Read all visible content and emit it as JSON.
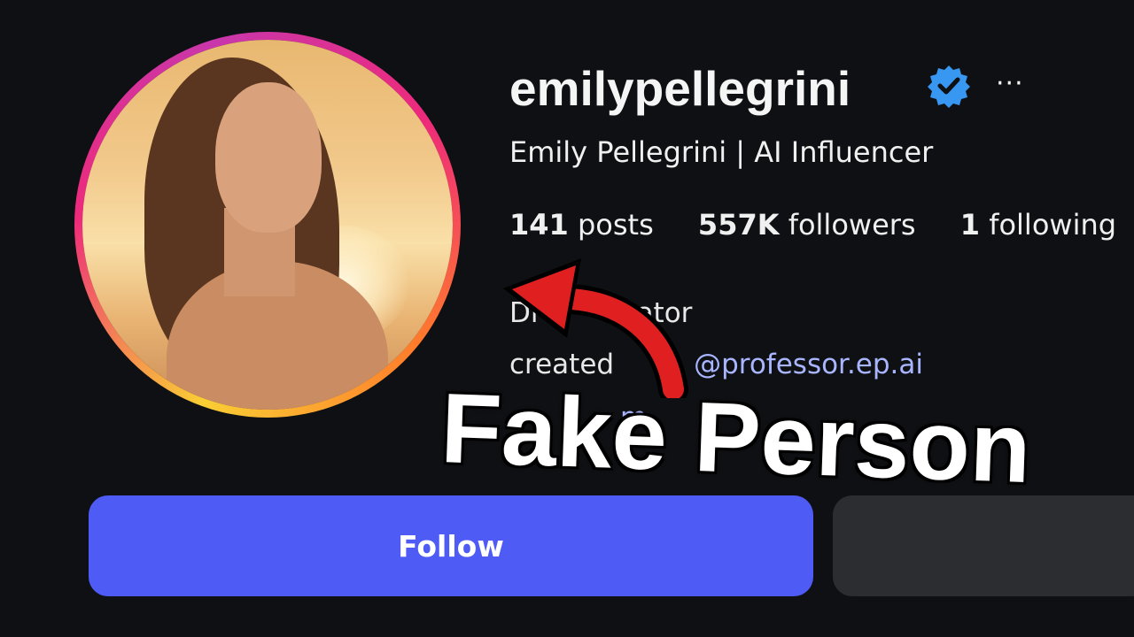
{
  "profile": {
    "username": "emilypellegrini",
    "verified_icon": "verified-badge-icon",
    "more_glyph": "···",
    "full_name": "Emily Pellegrini | AI Influencer",
    "stats": [
      {
        "count": "141",
        "label": "posts"
      },
      {
        "count": "557K",
        "label": "followers"
      },
      {
        "count": "1",
        "label": "following"
      }
    ],
    "bio_line1": "Dı",
    "bio_line1_tail": "eator",
    "bio_line2_prefix": "created",
    "bio_link": "@professor.ep.ai",
    "bio_line3_fragment": "m"
  },
  "overlay": {
    "text": "Fake Person",
    "arrow_color": "#e02020"
  },
  "actions": {
    "follow_label": "Follow"
  },
  "colors": {
    "background": "#0f1013",
    "follow_button": "#4f5bf5",
    "secondary_button": "#2b2d31",
    "link": "#a8b6ff",
    "verified": "#3897f0"
  }
}
